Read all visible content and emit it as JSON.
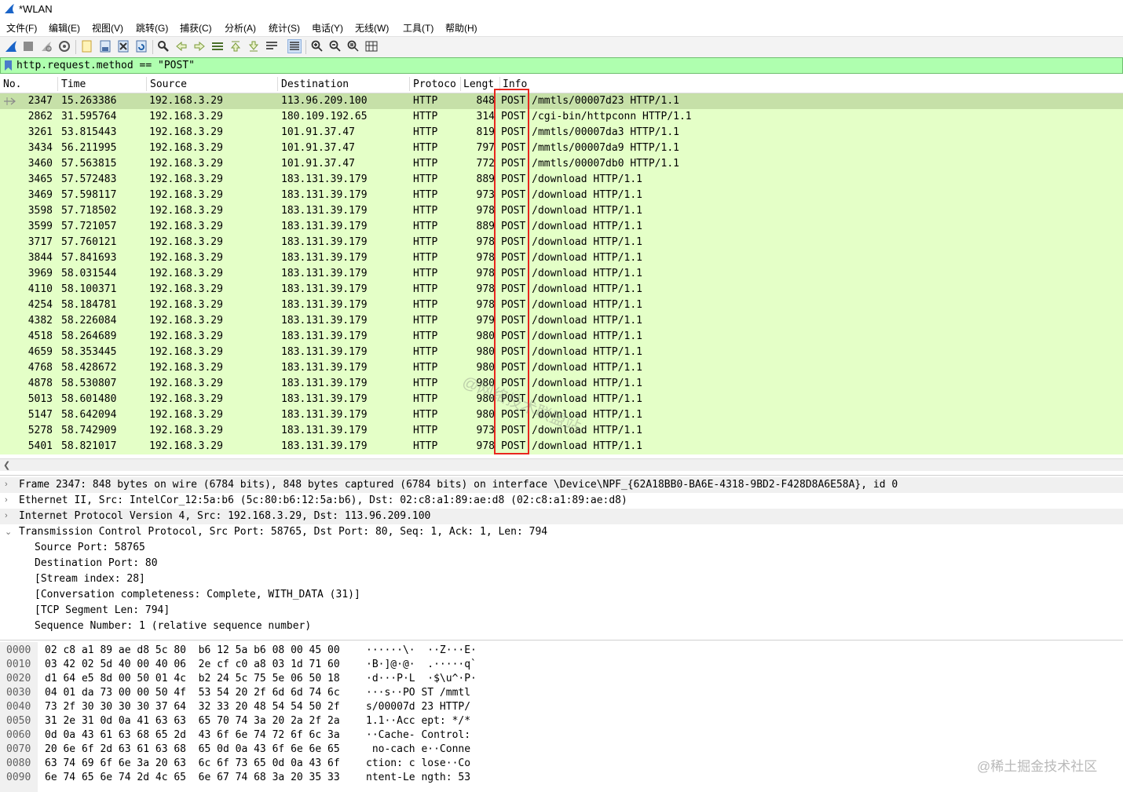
{
  "window": {
    "title": "*WLAN"
  },
  "menu": [
    "文件(F)",
    "编辑(E)",
    "视图(V)",
    "跳转(G)",
    "捕获(C)",
    "分析(A)",
    "统计(S)",
    "电话(Y)",
    "无线(W)",
    "工具(T)",
    "帮助(H)"
  ],
  "toolbar": {
    "icons": [
      "shark-fin-icon",
      "stop-icon",
      "restart-icon",
      "options-icon",
      "open-icon",
      "save-icon",
      "close-file-icon",
      "reload-icon",
      "find-icon",
      "back-icon",
      "forward-icon",
      "goto-icon",
      "first-icon",
      "last-icon",
      "autoscroll-icon",
      "colorize-icon",
      "zoom-in-icon",
      "zoom-out-icon",
      "zoom-normal-icon",
      "resize-columns-icon"
    ]
  },
  "filter": {
    "value": "http.request.method == \"POST\""
  },
  "packet_list": {
    "columns": [
      "No.",
      "Time",
      "Source",
      "Destination",
      "Protoco",
      "Lengt",
      "Info"
    ],
    "rows": [
      {
        "no": "2347",
        "time": "15.263386",
        "src": "192.168.3.29",
        "dst": "113.96.209.100",
        "proto": "HTTP",
        "len": "848",
        "info": "POST /mmtls/00007d23 HTTP/1.1",
        "selected": true
      },
      {
        "no": "2862",
        "time": "31.595764",
        "src": "192.168.3.29",
        "dst": "180.109.192.65",
        "proto": "HTTP",
        "len": "314",
        "info": "POST /cgi-bin/httpconn HTTP/1.1"
      },
      {
        "no": "3261",
        "time": "53.815443",
        "src": "192.168.3.29",
        "dst": "101.91.37.47",
        "proto": "HTTP",
        "len": "819",
        "info": "POST /mmtls/00007da3 HTTP/1.1"
      },
      {
        "no": "3434",
        "time": "56.211995",
        "src": "192.168.3.29",
        "dst": "101.91.37.47",
        "proto": "HTTP",
        "len": "797",
        "info": "POST /mmtls/00007da9 HTTP/1.1"
      },
      {
        "no": "3460",
        "time": "57.563815",
        "src": "192.168.3.29",
        "dst": "101.91.37.47",
        "proto": "HTTP",
        "len": "772",
        "info": "POST /mmtls/00007db0 HTTP/1.1"
      },
      {
        "no": "3465",
        "time": "57.572483",
        "src": "192.168.3.29",
        "dst": "183.131.39.179",
        "proto": "HTTP",
        "len": "889",
        "info": "POST /download HTTP/1.1"
      },
      {
        "no": "3469",
        "time": "57.598117",
        "src": "192.168.3.29",
        "dst": "183.131.39.179",
        "proto": "HTTP",
        "len": "973",
        "info": "POST /download HTTP/1.1"
      },
      {
        "no": "3598",
        "time": "57.718502",
        "src": "192.168.3.29",
        "dst": "183.131.39.179",
        "proto": "HTTP",
        "len": "978",
        "info": "POST /download HTTP/1.1"
      },
      {
        "no": "3599",
        "time": "57.721057",
        "src": "192.168.3.29",
        "dst": "183.131.39.179",
        "proto": "HTTP",
        "len": "889",
        "info": "POST /download HTTP/1.1"
      },
      {
        "no": "3717",
        "time": "57.760121",
        "src": "192.168.3.29",
        "dst": "183.131.39.179",
        "proto": "HTTP",
        "len": "978",
        "info": "POST /download HTTP/1.1"
      },
      {
        "no": "3844",
        "time": "57.841693",
        "src": "192.168.3.29",
        "dst": "183.131.39.179",
        "proto": "HTTP",
        "len": "978",
        "info": "POST /download HTTP/1.1"
      },
      {
        "no": "3969",
        "time": "58.031544",
        "src": "192.168.3.29",
        "dst": "183.131.39.179",
        "proto": "HTTP",
        "len": "978",
        "info": "POST /download HTTP/1.1"
      },
      {
        "no": "4110",
        "time": "58.100371",
        "src": "192.168.3.29",
        "dst": "183.131.39.179",
        "proto": "HTTP",
        "len": "978",
        "info": "POST /download HTTP/1.1"
      },
      {
        "no": "4254",
        "time": "58.184781",
        "src": "192.168.3.29",
        "dst": "183.131.39.179",
        "proto": "HTTP",
        "len": "978",
        "info": "POST /download HTTP/1.1"
      },
      {
        "no": "4382",
        "time": "58.226084",
        "src": "192.168.3.29",
        "dst": "183.131.39.179",
        "proto": "HTTP",
        "len": "979",
        "info": "POST /download HTTP/1.1"
      },
      {
        "no": "4518",
        "time": "58.264689",
        "src": "192.168.3.29",
        "dst": "183.131.39.179",
        "proto": "HTTP",
        "len": "980",
        "info": "POST /download HTTP/1.1"
      },
      {
        "no": "4659",
        "time": "58.353445",
        "src": "192.168.3.29",
        "dst": "183.131.39.179",
        "proto": "HTTP",
        "len": "980",
        "info": "POST /download HTTP/1.1"
      },
      {
        "no": "4768",
        "time": "58.428672",
        "src": "192.168.3.29",
        "dst": "183.131.39.179",
        "proto": "HTTP",
        "len": "980",
        "info": "POST /download HTTP/1.1"
      },
      {
        "no": "4878",
        "time": "58.530807",
        "src": "192.168.3.29",
        "dst": "183.131.39.179",
        "proto": "HTTP",
        "len": "980",
        "info": "POST /download HTTP/1.1"
      },
      {
        "no": "5013",
        "time": "58.601480",
        "src": "192.168.3.29",
        "dst": "183.131.39.179",
        "proto": "HTTP",
        "len": "980",
        "info": "POST /download HTTP/1.1"
      },
      {
        "no": "5147",
        "time": "58.642094",
        "src": "192.168.3.29",
        "dst": "183.131.39.179",
        "proto": "HTTP",
        "len": "980",
        "info": "POST /download HTTP/1.1"
      },
      {
        "no": "5278",
        "time": "58.742909",
        "src": "192.168.3.29",
        "dst": "183.131.39.179",
        "proto": "HTTP",
        "len": "973",
        "info": "POST /download HTTP/1.1"
      },
      {
        "no": "5401",
        "time": "58.821017",
        "src": "192.168.3.29",
        "dst": "183.131.39.179",
        "proto": "HTTP",
        "len": "978",
        "info": "POST /download HTTP/1.1"
      }
    ],
    "highlight_color": "#e8271e"
  },
  "details": {
    "lines": [
      {
        "text": "Frame 2347: 848 bytes on wire (6784 bits), 848 bytes captured (6784 bits) on interface \\Device\\NPF_{62A18BB0-BA6E-4318-9BD2-F428D8A6E58A}, id 0",
        "level": 0,
        "toggle": "›",
        "band": true
      },
      {
        "text": "Ethernet II, Src: IntelCor_12:5a:b6 (5c:80:b6:12:5a:b6), Dst: 02:c8:a1:89:ae:d8 (02:c8:a1:89:ae:d8)",
        "level": 0,
        "toggle": "›",
        "band": false
      },
      {
        "text": "Internet Protocol Version 4, Src: 192.168.3.29, Dst: 113.96.209.100",
        "level": 0,
        "toggle": "›",
        "band": true
      },
      {
        "text": "Transmission Control Protocol, Src Port: 58765, Dst Port: 80, Seq: 1, Ack: 1, Len: 794",
        "level": 0,
        "toggle": "⌄",
        "band": false
      },
      {
        "text": "Source Port: 58765",
        "level": 1,
        "band": false
      },
      {
        "text": "Destination Port: 80",
        "level": 1,
        "band": false
      },
      {
        "text": "[Stream index: 28]",
        "level": 1,
        "band": false
      },
      {
        "text": "[Conversation completeness: Complete, WITH_DATA (31)]",
        "level": 1,
        "band": false
      },
      {
        "text": "[TCP Segment Len: 794]",
        "level": 1,
        "band": false
      },
      {
        "text": "Sequence Number: 1    (relative sequence number)",
        "level": 1,
        "band": false
      }
    ]
  },
  "bytes": {
    "lines": [
      {
        "off": "0000",
        "hex": "02 c8 a1 89 ae d8 5c 80  b6 12 5a b6 08 00 45 00",
        "ascii": "······\\·  ··Z···E·"
      },
      {
        "off": "0010",
        "hex": "03 42 02 5d 40 00 40 06  2e cf c0 a8 03 1d 71 60",
        "ascii": "·B·]@·@·  .·····q`"
      },
      {
        "off": "0020",
        "hex": "d1 64 e5 8d 00 50 01 4c  b2 24 5c 75 5e 06 50 18",
        "ascii": "·d···P·L  ·$\\u^·P·"
      },
      {
        "off": "0030",
        "hex": "04 01 da 73 00 00 50 4f  53 54 20 2f 6d 6d 74 6c",
        "ascii": "···s··PO ST /mmtl"
      },
      {
        "off": "0040",
        "hex": "73 2f 30 30 30 30 37 64  32 33 20 48 54 54 50 2f",
        "ascii": "s/00007d 23 HTTP/"
      },
      {
        "off": "0050",
        "hex": "31 2e 31 0d 0a 41 63 63  65 70 74 3a 20 2a 2f 2a",
        "ascii": "1.1··Acc ept: */*"
      },
      {
        "off": "0060",
        "hex": "0d 0a 43 61 63 68 65 2d  43 6f 6e 74 72 6f 6c 3a",
        "ascii": "··Cache- Control:"
      },
      {
        "off": "0070",
        "hex": "20 6e 6f 2d 63 61 63 68  65 0d 0a 43 6f 6e 6e 65",
        "ascii": " no-cach e··Conne"
      },
      {
        "off": "0080",
        "hex": "63 74 69 6f 6e 3a 20 63  6c 6f 73 65 0d 0a 43 6f",
        "ascii": "ction: c lose··Co"
      },
      {
        "off": "0090",
        "hex": "6e 74 65 6e 74 2d 4c 65  6e 67 74 68 3a 20 35 33",
        "ascii": "ntent-Le ngth: 53"
      }
    ]
  },
  "watermarks": [
    "@网络技术联盟站",
    "@稀土掘金技术社区"
  ],
  "colors": {
    "filter_bg": "#afffaf",
    "row_bg": "#e4ffc7",
    "row_selected": "#c6e0a8",
    "red_box": "#e8271e"
  }
}
